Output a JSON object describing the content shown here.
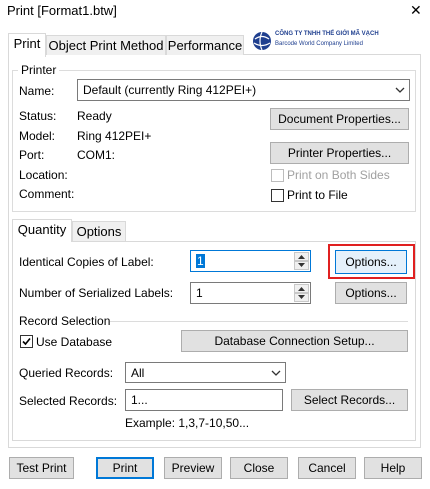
{
  "window": {
    "title": "Print [Format1.btw]",
    "close_glyph": "✕"
  },
  "tabs": [
    {
      "label": "Print",
      "active": true
    },
    {
      "label": "Object Print Method",
      "active": false
    },
    {
      "label": "Performance",
      "active": false
    }
  ],
  "logo": {
    "line1": "CÔNG TY TNHH THẾ GIỚI MÃ VẠCH",
    "line2": "Barcode World Company Limited",
    "color": "#1f3f8f"
  },
  "printer": {
    "group_title": "Printer",
    "name_label": "Name:",
    "name_value": "Default (currently Ring 412PEI+)",
    "status_label": "Status:",
    "status_value": "Ready",
    "model_label": "Model:",
    "model_value": "Ring 412PEI+",
    "port_label": "Port:",
    "port_value": "COM1:",
    "location_label": "Location:",
    "comment_label": "Comment:",
    "doc_props_button": "Document Properties...",
    "printer_props_button": "Printer Properties...",
    "print_both_sides": "Print on Both Sides",
    "print_to_file": "Print to File"
  },
  "subtabs": [
    {
      "label": "Quantity",
      "active": true
    },
    {
      "label": "Options",
      "active": false
    }
  ],
  "quantity": {
    "identical_label": "Identical Copies of Label:",
    "identical_value": "1",
    "serialized_label": "Number of Serialized Labels:",
    "serialized_value": "1",
    "options_button_1": "Options...",
    "options_button_2": "Options...",
    "highlight_color": "#e02020"
  },
  "record_selection": {
    "title": "Record Selection",
    "use_database": "Use Database",
    "use_database_checked": true,
    "db_setup_button": "Database Connection Setup...",
    "queried_label": "Queried Records:",
    "queried_value": "All",
    "selected_label": "Selected Records:",
    "selected_value": "1...",
    "select_records_button": "Select Records...",
    "example_text": "Example: 1,3,7-10,50..."
  },
  "footer": {
    "test_print": "Test Print",
    "print": "Print",
    "preview": "Preview",
    "close": "Close",
    "cancel": "Cancel",
    "help": "Help"
  }
}
